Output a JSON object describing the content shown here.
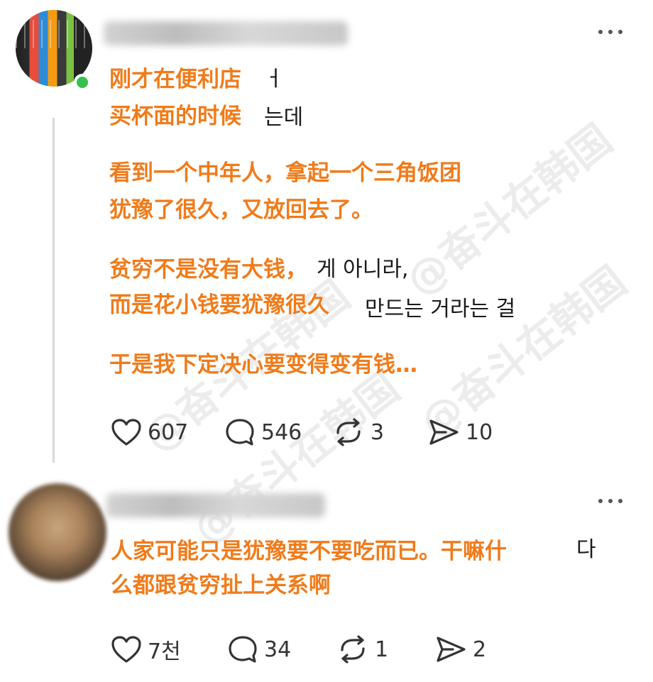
{
  "post1": {
    "lines": [
      "刚才在便利店",
      "买杯面的时候",
      "看到一个中年人，拿起一个三角饭团",
      "犹豫了很久，又放回去了。",
      "贫穷不是没有大钱，",
      "而是花小钱要犹豫很久",
      "于是我下定决心要变得变有钱…"
    ],
    "underlying_text": [
      "ㅓ",
      "는데",
      "게 아니라,",
      "만드는 거라는 걸"
    ],
    "actions": {
      "likes": "607",
      "comments": "546",
      "reposts": "3",
      "shares": "10"
    }
  },
  "post2": {
    "lines": [
      "人家可能只是犹豫要不要吃而已。干嘛什",
      "么都跟贫穷扯上关系啊"
    ],
    "underlying_text": [
      "다"
    ],
    "actions": {
      "likes": "7천",
      "comments": "34",
      "reposts": "1",
      "shares": "2"
    }
  },
  "watermarks": [
    "@奋斗在韩国",
    "@奋斗在韩国",
    "@奋斗在韩国",
    "@奋斗在韩国"
  ],
  "colors": {
    "overlay_text": "#f07b1a",
    "online": "#33c24d",
    "icon": "#333333"
  },
  "icons": {
    "like": "heart-icon",
    "comment": "comment-bubble-icon",
    "repost": "repost-arrows-icon",
    "share": "send-icon",
    "more": "more-dots-icon"
  }
}
